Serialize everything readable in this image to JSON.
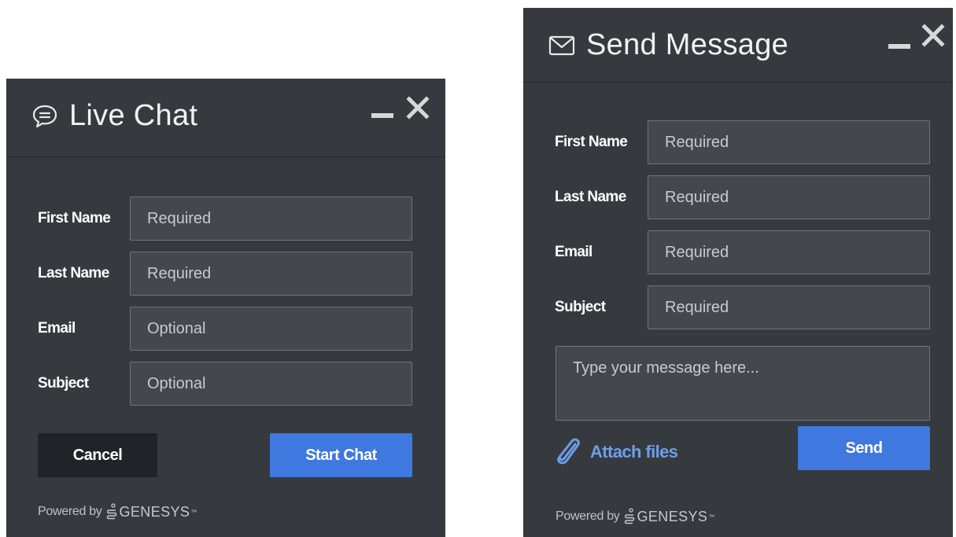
{
  "chat": {
    "title": "Live Chat",
    "icons": {
      "header": "chat-bubble-icon",
      "minimize": "minimize-icon",
      "close": "close-icon"
    },
    "fields": [
      {
        "label": "First Name",
        "placeholder": "Required"
      },
      {
        "label": "Last Name",
        "placeholder": "Required"
      },
      {
        "label": "Email",
        "placeholder": "Optional"
      },
      {
        "label": "Subject",
        "placeholder": "Optional"
      }
    ],
    "cancel_label": "Cancel",
    "start_label": "Start Chat",
    "powered_by": "Powered by",
    "brand": "GENESYS",
    "brand_mark": "™"
  },
  "message": {
    "title": "Send Message",
    "icons": {
      "header": "envelope-icon",
      "minimize": "minimize-icon",
      "close": "close-icon",
      "attach": "paperclip-icon"
    },
    "fields": [
      {
        "label": "First Name",
        "placeholder": "Required"
      },
      {
        "label": "Last Name",
        "placeholder": "Required"
      },
      {
        "label": "Email",
        "placeholder": "Required"
      },
      {
        "label": "Subject",
        "placeholder": "Required"
      }
    ],
    "message_placeholder": "Type your message here...",
    "attach_label": "Attach files",
    "send_label": "Send",
    "powered_by": "Powered by",
    "brand": "GENESYS",
    "brand_mark": "™"
  },
  "colors": {
    "panel_bg": "#363a3f",
    "field_bg": "#45474f",
    "primary_button": "#3f78de",
    "cancel_button": "#202327",
    "link": "#6d9ee8"
  }
}
